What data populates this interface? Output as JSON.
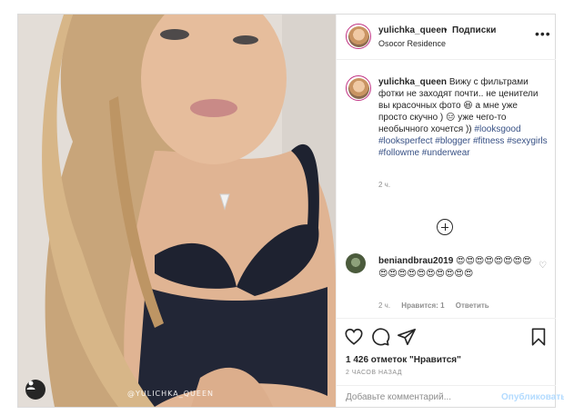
{
  "photo": {
    "watermark": "@YULICHKA_QUEEN",
    "user_tag_icon": "person-icon"
  },
  "header": {
    "username": "yulichka_queen",
    "separator": "•",
    "follow_label": "Подписки",
    "location": "Osocor Residence",
    "more_icon": "more-horizontal-icon"
  },
  "caption": {
    "username": "yulichka_queen",
    "text": "Вижу с фильтрами фотки не заходят почти.. не ценители вы красочных фото 😆 а мне уже просто скучно ) 😑 уже чего-то необычного хочется ))",
    "hashtags": "#looksgood #looksperfect #blogger #fitness #sexygirls #followme #underwear",
    "time": "2 ч."
  },
  "load_more_icon": "plus-circle-icon",
  "comment": {
    "username": "beniandbrau2019",
    "text": "😍😍😍😍😍😍😍😍😍😍😍😍😍😍😍😍😍😍",
    "time": "2 ч.",
    "likes": "Нравится: 1",
    "reply": "Ответить",
    "like_icon": "heart-outline-icon"
  },
  "actions": {
    "like_icon": "heart-icon",
    "comment_icon": "comment-icon",
    "share_icon": "share-icon",
    "save_icon": "bookmark-icon",
    "likes_text": "1 426 отметок \"Нравится\"",
    "posted_ago": "2 ЧАСОВ НАЗАД"
  },
  "add_comment": {
    "placeholder": "Добавьте комментарий...",
    "publish_label": "Опубликовать"
  },
  "colors": {
    "accent_link": "#385185",
    "publish_disabled": "#b3dbff",
    "avatar_ring": "#c13584"
  }
}
